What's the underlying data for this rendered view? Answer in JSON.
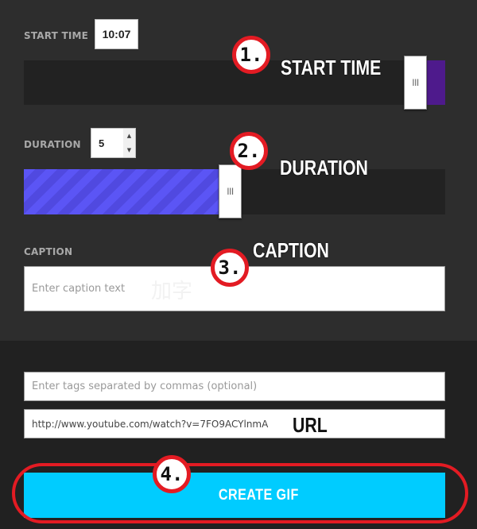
{
  "start_time": {
    "label": "START TIME",
    "value": "10:07",
    "slider_handle_glyph": "III",
    "position_fraction": 0.96
  },
  "duration": {
    "label": "DURATION",
    "value": "5",
    "spin_up_glyph": "▲",
    "spin_down_glyph": "▼",
    "slider_handle_glyph": "III",
    "fill_fraction": 0.47
  },
  "caption": {
    "label": "CAPTION",
    "placeholder": "Enter caption text",
    "watermark": "加字"
  },
  "tags": {
    "placeholder": "Enter tags separated by commas (optional)"
  },
  "url": {
    "value": "http://www.youtube.com/watch?v=7FO9ACYlnmA"
  },
  "create_button": {
    "label": "CREATE GIF"
  },
  "annotations": [
    {
      "number": "1.",
      "text": "START TIME"
    },
    {
      "number": "2.",
      "text": "DURATION"
    },
    {
      "number": "3.",
      "text": "CAPTION"
    },
    {
      "number": "4.",
      "text": ""
    },
    {
      "number": "",
      "text": "URL"
    }
  ],
  "colors": {
    "accent_button": "#00ccff",
    "start_fill": "#4e1a8c",
    "duration_fill": "#5b55f5",
    "annotation_red": "#e31b23"
  }
}
